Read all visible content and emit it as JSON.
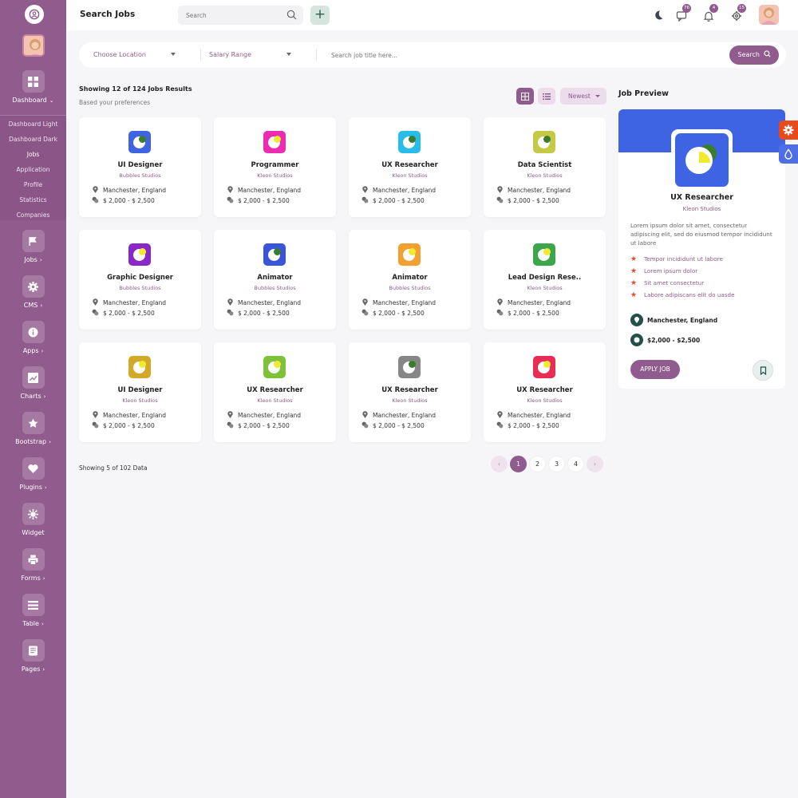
{
  "colors": {
    "primary": "#905b8d",
    "sidebar": "#905b8d",
    "accent_blue": "#3e64e4",
    "star": "#e8492c",
    "settings_tab": "#e84a1c",
    "theme_tab": "#4f6ee5"
  },
  "header": {
    "title": "Search Jobs",
    "search_placeholder": "Search",
    "badges": {
      "messages": "76",
      "notifications": "4",
      "settings": "15"
    }
  },
  "sidebar": {
    "dashboard_label": "Dashboard",
    "submenu": [
      "Dashboard Light",
      "Dashboard Dark",
      "Jobs",
      "Application",
      "Profile",
      "Statistics",
      "Companies"
    ],
    "items": [
      {
        "label": "Jobs",
        "icon": "flag-icon"
      },
      {
        "label": "CMS",
        "icon": "gear-icon"
      },
      {
        "label": "Apps",
        "icon": "info-icon"
      },
      {
        "label": "Charts",
        "icon": "chart-icon"
      },
      {
        "label": "Bootstrap",
        "icon": "star-icon"
      },
      {
        "label": "Plugins",
        "icon": "heart-icon"
      },
      {
        "label": "Widget",
        "icon": "widget-icon"
      },
      {
        "label": "Forms",
        "icon": "printer-icon"
      },
      {
        "label": "Table",
        "icon": "table-icon"
      },
      {
        "label": "Pages",
        "icon": "pages-icon"
      }
    ]
  },
  "filters": {
    "location": "Choose Location",
    "salary": "Salary Range",
    "job_search_placeholder": "Search job title here...",
    "search_button": "Search"
  },
  "results": {
    "title": "Showing 12 of 124 Jobs Results",
    "subtitle": "Based your preferences",
    "sort": "Newest"
  },
  "jobs": [
    {
      "title": "UI Designer",
      "company": "Bubbles Studios",
      "location": "Manchester, England",
      "salary": "$ 2,000 - $ 2,500",
      "color": "#3e64e4",
      "accent": "#3b7d2e"
    },
    {
      "title": "Programmer",
      "company": "Kleon Studios",
      "location": "Manchester, England",
      "salary": "$ 2,000 - $ 2,500",
      "color": "#ec2bb0",
      "accent": "#f2ea2e"
    },
    {
      "title": "UX Researcher",
      "company": "Kleon Studios",
      "location": "Manchester, England",
      "salary": "$ 2,000 - $ 2,500",
      "color": "#27bde8",
      "accent": "#3b7d2e"
    },
    {
      "title": "Data Scientist",
      "company": "Kleon Studios",
      "location": "Manchester, England",
      "salary": "$ 2,000 - $ 2,500",
      "color": "#c5ca46",
      "accent": "#3b7d2e"
    },
    {
      "title": "Graphic Designer",
      "company": "Bubbles Studios",
      "location": "Manchester, England",
      "salary": "$ 2,000 - $ 2,500",
      "color": "#8928c9",
      "accent": "#f2ea2e"
    },
    {
      "title": "Animator",
      "company": "Bubbles Studios",
      "location": "Manchester, England",
      "salary": "$ 2,000 - $ 2,500",
      "color": "#3a56d8",
      "accent": "#3b7d2e"
    },
    {
      "title": "Animator",
      "company": "Bubbles Studios",
      "location": "Manchester, England",
      "salary": "$ 2,000 - $ 2,500",
      "color": "#f2a031",
      "accent": "#f2ea2e"
    },
    {
      "title": "Lead Design Rese..",
      "company": "Kleon Studios",
      "location": "Manchester, England",
      "salary": "$ 2,000 - $ 2,500",
      "color": "#3da54b",
      "accent": "#f2ea2e"
    },
    {
      "title": "UI Designer",
      "company": "Kleon Studios",
      "location": "Manchester, England",
      "salary": "$ 2,000 - $ 2,500",
      "color": "#d4a92a",
      "accent": "#f2ea2e"
    },
    {
      "title": "UX Researcher",
      "company": "Kleon Studios",
      "location": "Manchester, England",
      "salary": "$ 2,000 - $ 2,500",
      "color": "#7dc23a",
      "accent": "#f2ea2e"
    },
    {
      "title": "UX Researcher",
      "company": "Kleon Studios",
      "location": "Manchester, England",
      "salary": "$ 2,000 - $ 2,500",
      "color": "#868686",
      "accent": "#3b7d2e"
    },
    {
      "title": "UX Researcher",
      "company": "Kleon Studios",
      "location": "Manchester, England",
      "salary": "$ 2,000 - $ 2,500",
      "color": "#e82c55",
      "accent": "#f2ea2e"
    }
  ],
  "footer": {
    "note": "Showing 5 of 102 Data",
    "pages": [
      "1",
      "2",
      "3",
      "4"
    ],
    "current_page": "1",
    "prev": "‹",
    "next": "›"
  },
  "preview": {
    "heading": "Job Preview",
    "title": "UX Researcher",
    "company": "Kleon Studios",
    "description": "Lorem ipsum dolor sit amet, consectetur adipiscing elit, sed do eiusmod tempor incididunt ut labore",
    "bullets": [
      "Tempor incididunt ut labore",
      "Lorem ipsum dolor",
      "Sit amet consectetur",
      "Labore adipiscans elit do uasde"
    ],
    "location": "Manchester, England",
    "salary": "$2,000 - $2,500",
    "apply_label": "APPLY JOB"
  }
}
